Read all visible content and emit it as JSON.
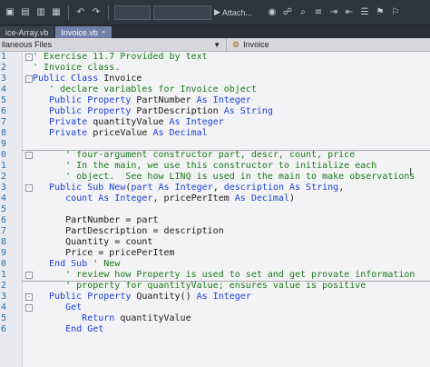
{
  "toolbar": {
    "attach_label": "Attach..."
  },
  "tabs": [
    {
      "label": "ice-Array.vb",
      "active": false
    },
    {
      "label": "Invoice.vb",
      "close": "×",
      "active": true
    }
  ],
  "navbar": {
    "left_label": "llaneous Files",
    "right_label": "Invoice"
  },
  "code_lines": [
    {
      "n": "1",
      "fold": "-",
      "segs": [
        [
          "cm",
          "' Exercise 11.7 Provided by text"
        ]
      ]
    },
    {
      "n": "2",
      "segs": [
        [
          "cm",
          "' Invoice class."
        ]
      ]
    },
    {
      "n": "3",
      "fold": "-",
      "segs": [
        [
          "kw",
          "Public Class "
        ],
        [
          "tx",
          "Invoice"
        ]
      ]
    },
    {
      "n": "4",
      "segs": [
        [
          "cm",
          "   ' declare variables for Invoice object"
        ]
      ]
    },
    {
      "n": "5",
      "segs": [
        [
          "kw",
          "   Public Property "
        ],
        [
          "tx",
          "PartNumber "
        ],
        [
          "kw",
          "As Integer"
        ]
      ]
    },
    {
      "n": "6",
      "segs": [
        [
          "kw",
          "   Public Property "
        ],
        [
          "tx",
          "PartDescription "
        ],
        [
          "kw",
          "As String"
        ]
      ]
    },
    {
      "n": "7",
      "segs": [
        [
          "kw",
          "   Private "
        ],
        [
          "tx",
          "quantityValue "
        ],
        [
          "kw",
          "As Integer"
        ]
      ]
    },
    {
      "n": "8",
      "segs": [
        [
          "kw",
          "   Private "
        ],
        [
          "tx",
          "priceValue "
        ],
        [
          "kw",
          "As Decimal"
        ]
      ]
    },
    {
      "n": "9",
      "segs": []
    },
    {
      "n": "0",
      "fold": "-",
      "segs": [
        [
          "cm",
          "      ' four-argument constructor part, descr, count, price"
        ]
      ]
    },
    {
      "n": "1",
      "segs": [
        [
          "cm",
          "      ' In the main, we use this constructor to initialize each"
        ]
      ]
    },
    {
      "n": "2",
      "segs": [
        [
          "cm",
          "      ' object.  See how LINQ is used in the main to make observations"
        ]
      ]
    },
    {
      "n": "3",
      "fold": "-",
      "segs": [
        [
          "kw",
          "   Public Sub New"
        ],
        [
          "tx",
          "("
        ],
        [
          "kw",
          "part As Integer"
        ],
        [
          "tx",
          ", "
        ],
        [
          "kw",
          "description As String"
        ],
        [
          "tx",
          ","
        ]
      ]
    },
    {
      "n": "4",
      "segs": [
        [
          "kw",
          "      count As Integer"
        ],
        [
          "tx",
          ", pricePerItem "
        ],
        [
          "kw",
          "As Decimal"
        ],
        [
          "tx",
          ")"
        ]
      ]
    },
    {
      "n": "5",
      "segs": []
    },
    {
      "n": "6",
      "segs": [
        [
          "tx",
          "      PartNumber = part"
        ]
      ]
    },
    {
      "n": "7",
      "segs": [
        [
          "tx",
          "      PartDescription = description"
        ]
      ]
    },
    {
      "n": "8",
      "segs": [
        [
          "tx",
          "      Quantity = count"
        ]
      ]
    },
    {
      "n": "9",
      "segs": [
        [
          "tx",
          "      Price = pricePerItem"
        ]
      ]
    },
    {
      "n": "0",
      "segs": [
        [
          "kw",
          "   End Sub "
        ],
        [
          "cm",
          "' New"
        ]
      ]
    },
    {
      "n": "1",
      "fold": "-",
      "segs": [
        [
          "cm",
          "      ' review how Property is used to set and get provate information"
        ]
      ]
    },
    {
      "n": "2",
      "segs": [
        [
          "cm",
          "      ' property for quantityValue; ensures value is positive"
        ]
      ]
    },
    {
      "n": "3",
      "fold": "-",
      "segs": [
        [
          "kw",
          "   Public Property "
        ],
        [
          "tx",
          "Quantity() "
        ],
        [
          "kw",
          "As Integer"
        ]
      ]
    },
    {
      "n": "4",
      "fold": "-",
      "segs": [
        [
          "kw",
          "      Get"
        ]
      ]
    },
    {
      "n": "5",
      "segs": [
        [
          "kw",
          "         Return "
        ],
        [
          "tx",
          "quantityValue"
        ]
      ]
    },
    {
      "n": "6",
      "segs": [
        [
          "kw",
          "      End Get"
        ]
      ]
    }
  ]
}
